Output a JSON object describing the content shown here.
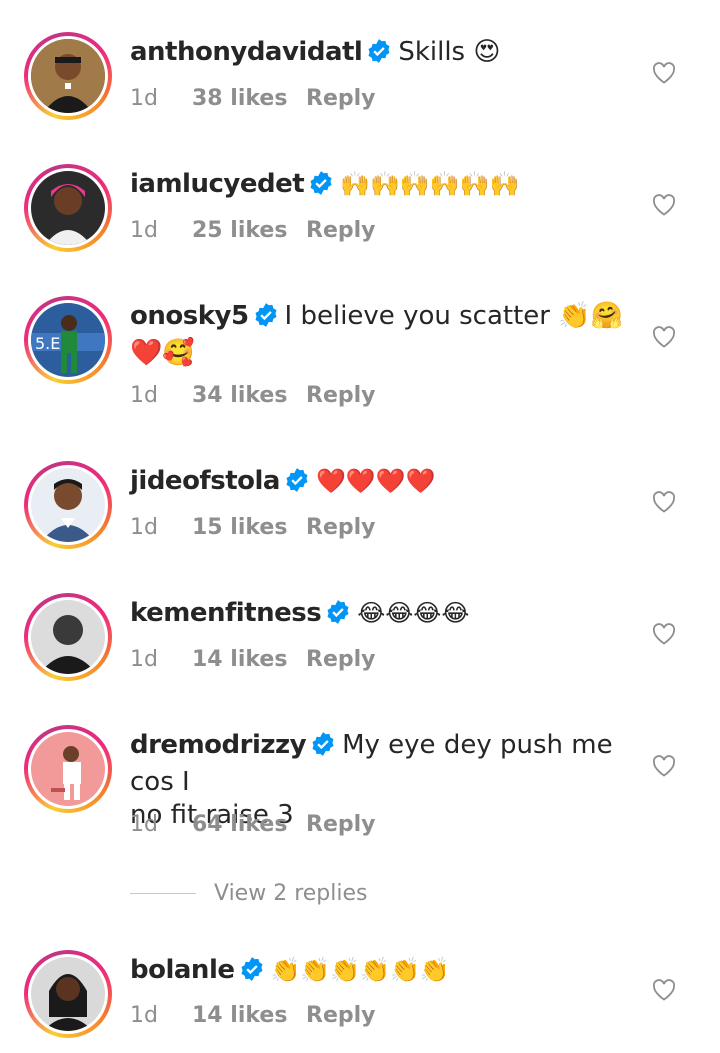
{
  "comments": [
    {
      "username": "anthonydavidatl",
      "text": "Skills 😍",
      "time": "1d",
      "likes": "38 likes",
      "reply": "Reply",
      "avatar": {
        "bg": "#7a5a2e",
        "skin": "#8a5a3a",
        "cloth": "#1a1a1a"
      }
    },
    {
      "username": "iamlucyedet",
      "text": "🙌🙌🙌🙌🙌🙌",
      "time": "1d",
      "likes": "25 likes",
      "reply": "Reply",
      "avatar": {
        "bg": "#2b2b2b",
        "skin": "#6a3e26",
        "cloth": "#e83a8a"
      }
    },
    {
      "username": "onosky5",
      "text": "I believe you scatter 👏🤗",
      "text2": "❤️🥰",
      "time": "1d",
      "likes": "34 likes",
      "reply": "Reply",
      "avatar": {
        "bg": "#2c5e9e",
        "skin": "#4a2c1a",
        "cloth": "#1f8a3a"
      }
    },
    {
      "username": "jideofstola",
      "text": "❤️❤️❤️❤️",
      "time": "1d",
      "likes": "15 likes",
      "reply": "Reply",
      "avatar": {
        "bg": "#e8eef3",
        "skin": "#7a4a2e",
        "cloth": "#3a5a8a"
      }
    },
    {
      "username": "kemenfitness",
      "text": "😂😂😂😂",
      "time": "1d",
      "likes": "14 likes",
      "reply": "Reply",
      "avatar": {
        "bg": "#dcdcdc",
        "skin": "#3a3a3a",
        "cloth": "#1a1a1a"
      }
    },
    {
      "username": "dremodrizzy",
      "text": "My eye dey push me cos I",
      "text2": "no fit raise 3",
      "time": "1d",
      "likes": "64 likes",
      "reply": "Reply",
      "avatar": {
        "bg": "#f29a9a",
        "skin": "#6a4028",
        "cloth": "#ffffff"
      }
    },
    {
      "username": "bolanle",
      "text": "👏👏👏👏👏👏",
      "time": "1d",
      "likes": "14 likes",
      "reply": "Reply",
      "avatar": {
        "bg": "#d9d9d9",
        "skin": "#5a3420",
        "cloth": "#1a1a1a"
      }
    }
  ],
  "view_replies": "View 2 replies",
  "colors": {
    "verified": "#0095f6",
    "meta": "#8e8e8e",
    "text": "#262626"
  },
  "icons": {
    "verified": "verified-badge-icon",
    "like": "heart-outline-icon"
  }
}
